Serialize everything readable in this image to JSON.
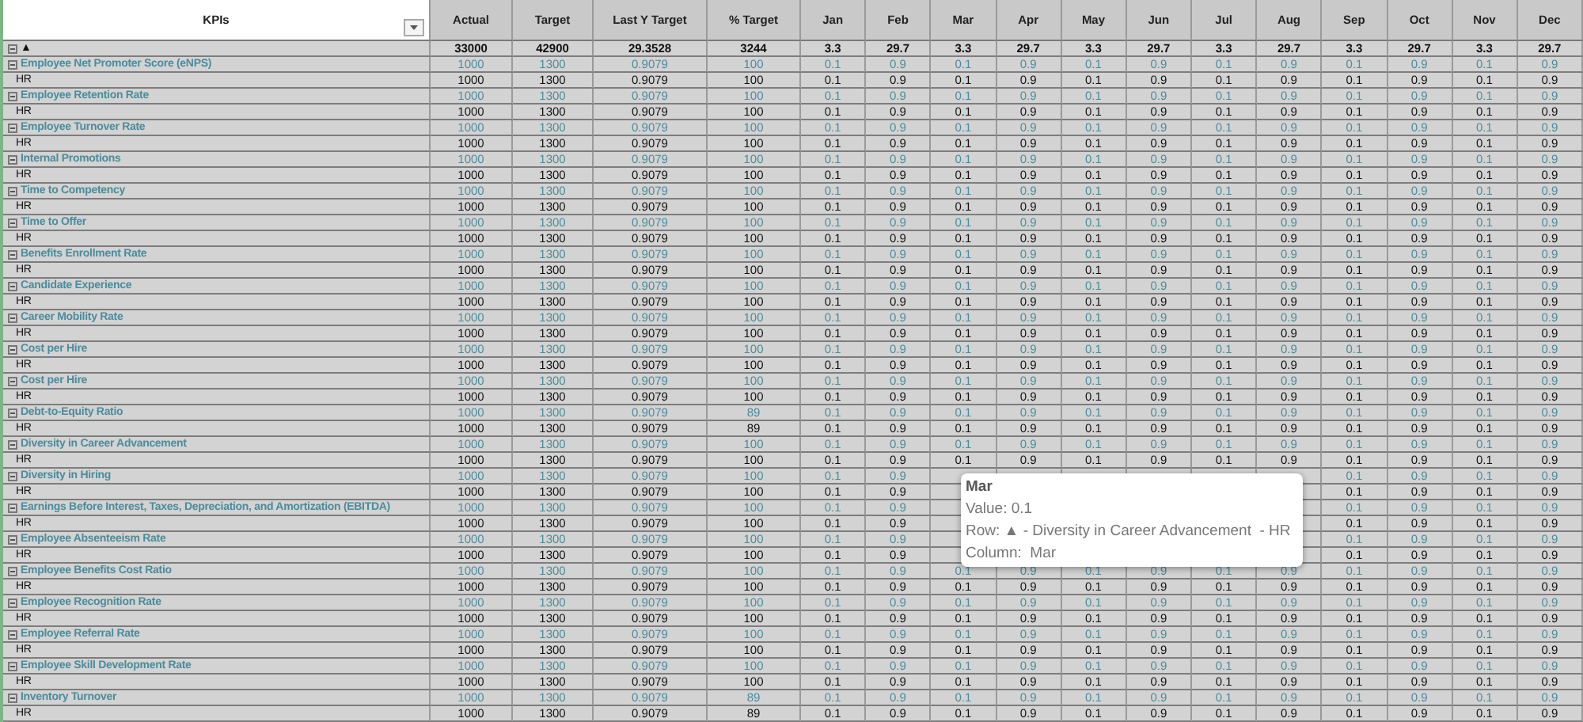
{
  "columns": [
    "KPIs",
    "Actual",
    "Target",
    "Last Y Target",
    "% Target",
    "Jan",
    "Feb",
    "Mar",
    "Apr",
    "May",
    "Jun",
    "Jul",
    "Aug",
    "Sep",
    "Oct",
    "Nov",
    "Dec"
  ],
  "rows": [
    {
      "kind": "total",
      "expanded": true,
      "label": "▲",
      "values": [
        "33000",
        "42900",
        "29.3528",
        "3244",
        "3.3",
        "29.7",
        "3.3",
        "29.7",
        "3.3",
        "29.7",
        "3.3",
        "29.7",
        "3.3",
        "29.7",
        "3.3",
        "29.7"
      ]
    },
    {
      "kind": "kpi",
      "expanded": true,
      "label": "Employee Net Promoter Score (eNPS)",
      "values": [
        "1000",
        "1300",
        "0.9079",
        "100",
        "0.1",
        "0.9",
        "0.1",
        "0.9",
        "0.1",
        "0.9",
        "0.1",
        "0.9",
        "0.1",
        "0.9",
        "0.1",
        "0.9"
      ]
    },
    {
      "kind": "sub",
      "label": "HR",
      "values": [
        "1000",
        "1300",
        "0.9079",
        "100",
        "0.1",
        "0.9",
        "0.1",
        "0.9",
        "0.1",
        "0.9",
        "0.1",
        "0.9",
        "0.1",
        "0.9",
        "0.1",
        "0.9"
      ]
    },
    {
      "kind": "kpi",
      "expanded": true,
      "label": "Employee Retention Rate",
      "values": [
        "1000",
        "1300",
        "0.9079",
        "100",
        "0.1",
        "0.9",
        "0.1",
        "0.9",
        "0.1",
        "0.9",
        "0.1",
        "0.9",
        "0.1",
        "0.9",
        "0.1",
        "0.9"
      ]
    },
    {
      "kind": "sub",
      "label": "HR",
      "values": [
        "1000",
        "1300",
        "0.9079",
        "100",
        "0.1",
        "0.9",
        "0.1",
        "0.9",
        "0.1",
        "0.9",
        "0.1",
        "0.9",
        "0.1",
        "0.9",
        "0.1",
        "0.9"
      ]
    },
    {
      "kind": "kpi",
      "expanded": true,
      "label": "Employee Turnover Rate",
      "values": [
        "1000",
        "1300",
        "0.9079",
        "100",
        "0.1",
        "0.9",
        "0.1",
        "0.9",
        "0.1",
        "0.9",
        "0.1",
        "0.9",
        "0.1",
        "0.9",
        "0.1",
        "0.9"
      ]
    },
    {
      "kind": "sub",
      "label": "HR",
      "values": [
        "1000",
        "1300",
        "0.9079",
        "100",
        "0.1",
        "0.9",
        "0.1",
        "0.9",
        "0.1",
        "0.9",
        "0.1",
        "0.9",
        "0.1",
        "0.9",
        "0.1",
        "0.9"
      ]
    },
    {
      "kind": "kpi",
      "expanded": true,
      "label": "Internal Promotions",
      "values": [
        "1000",
        "1300",
        "0.9079",
        "100",
        "0.1",
        "0.9",
        "0.1",
        "0.9",
        "0.1",
        "0.9",
        "0.1",
        "0.9",
        "0.1",
        "0.9",
        "0.1",
        "0.9"
      ]
    },
    {
      "kind": "sub",
      "label": "HR",
      "values": [
        "1000",
        "1300",
        "0.9079",
        "100",
        "0.1",
        "0.9",
        "0.1",
        "0.9",
        "0.1",
        "0.9",
        "0.1",
        "0.9",
        "0.1",
        "0.9",
        "0.1",
        "0.9"
      ]
    },
    {
      "kind": "kpi",
      "expanded": true,
      "label": "Time to Competency",
      "values": [
        "1000",
        "1300",
        "0.9079",
        "100",
        "0.1",
        "0.9",
        "0.1",
        "0.9",
        "0.1",
        "0.9",
        "0.1",
        "0.9",
        "0.1",
        "0.9",
        "0.1",
        "0.9"
      ]
    },
    {
      "kind": "sub",
      "label": "HR",
      "values": [
        "1000",
        "1300",
        "0.9079",
        "100",
        "0.1",
        "0.9",
        "0.1",
        "0.9",
        "0.1",
        "0.9",
        "0.1",
        "0.9",
        "0.1",
        "0.9",
        "0.1",
        "0.9"
      ]
    },
    {
      "kind": "kpi",
      "expanded": true,
      "label": "Time to Offer",
      "values": [
        "1000",
        "1300",
        "0.9079",
        "100",
        "0.1",
        "0.9",
        "0.1",
        "0.9",
        "0.1",
        "0.9",
        "0.1",
        "0.9",
        "0.1",
        "0.9",
        "0.1",
        "0.9"
      ]
    },
    {
      "kind": "sub",
      "label": "HR",
      "values": [
        "1000",
        "1300",
        "0.9079",
        "100",
        "0.1",
        "0.9",
        "0.1",
        "0.9",
        "0.1",
        "0.9",
        "0.1",
        "0.9",
        "0.1",
        "0.9",
        "0.1",
        "0.9"
      ]
    },
    {
      "kind": "kpi",
      "expanded": true,
      "label": "Benefits Enrollment Rate",
      "values": [
        "1000",
        "1300",
        "0.9079",
        "100",
        "0.1",
        "0.9",
        "0.1",
        "0.9",
        "0.1",
        "0.9",
        "0.1",
        "0.9",
        "0.1",
        "0.9",
        "0.1",
        "0.9"
      ]
    },
    {
      "kind": "sub",
      "label": "HR",
      "values": [
        "1000",
        "1300",
        "0.9079",
        "100",
        "0.1",
        "0.9",
        "0.1",
        "0.9",
        "0.1",
        "0.9",
        "0.1",
        "0.9",
        "0.1",
        "0.9",
        "0.1",
        "0.9"
      ]
    },
    {
      "kind": "kpi",
      "expanded": true,
      "label": "Candidate Experience",
      "values": [
        "1000",
        "1300",
        "0.9079",
        "100",
        "0.1",
        "0.9",
        "0.1",
        "0.9",
        "0.1",
        "0.9",
        "0.1",
        "0.9",
        "0.1",
        "0.9",
        "0.1",
        "0.9"
      ]
    },
    {
      "kind": "sub",
      "label": "HR",
      "values": [
        "1000",
        "1300",
        "0.9079",
        "100",
        "0.1",
        "0.9",
        "0.1",
        "0.9",
        "0.1",
        "0.9",
        "0.1",
        "0.9",
        "0.1",
        "0.9",
        "0.1",
        "0.9"
      ]
    },
    {
      "kind": "kpi",
      "expanded": true,
      "label": "Career Mobility Rate",
      "values": [
        "1000",
        "1300",
        "0.9079",
        "100",
        "0.1",
        "0.9",
        "0.1",
        "0.9",
        "0.1",
        "0.9",
        "0.1",
        "0.9",
        "0.1",
        "0.9",
        "0.1",
        "0.9"
      ]
    },
    {
      "kind": "sub",
      "label": "HR",
      "values": [
        "1000",
        "1300",
        "0.9079",
        "100",
        "0.1",
        "0.9",
        "0.1",
        "0.9",
        "0.1",
        "0.9",
        "0.1",
        "0.9",
        "0.1",
        "0.9",
        "0.1",
        "0.9"
      ]
    },
    {
      "kind": "kpi",
      "expanded": true,
      "label": "Cost per Hire",
      "values": [
        "1000",
        "1300",
        "0.9079",
        "100",
        "0.1",
        "0.9",
        "0.1",
        "0.9",
        "0.1",
        "0.9",
        "0.1",
        "0.9",
        "0.1",
        "0.9",
        "0.1",
        "0.9"
      ]
    },
    {
      "kind": "sub",
      "label": "HR",
      "values": [
        "1000",
        "1300",
        "0.9079",
        "100",
        "0.1",
        "0.9",
        "0.1",
        "0.9",
        "0.1",
        "0.9",
        "0.1",
        "0.9",
        "0.1",
        "0.9",
        "0.1",
        "0.9"
      ]
    },
    {
      "kind": "kpi",
      "expanded": true,
      "label": "Cost per Hire",
      "values": [
        "1000",
        "1300",
        "0.9079",
        "100",
        "0.1",
        "0.9",
        "0.1",
        "0.9",
        "0.1",
        "0.9",
        "0.1",
        "0.9",
        "0.1",
        "0.9",
        "0.1",
        "0.9"
      ]
    },
    {
      "kind": "sub",
      "label": "HR",
      "values": [
        "1000",
        "1300",
        "0.9079",
        "100",
        "0.1",
        "0.9",
        "0.1",
        "0.9",
        "0.1",
        "0.9",
        "0.1",
        "0.9",
        "0.1",
        "0.9",
        "0.1",
        "0.9"
      ]
    },
    {
      "kind": "kpi",
      "expanded": true,
      "label": "Debt-to-Equity Ratio",
      "values": [
        "1000",
        "1300",
        "0.9079",
        "89",
        "0.1",
        "0.9",
        "0.1",
        "0.9",
        "0.1",
        "0.9",
        "0.1",
        "0.9",
        "0.1",
        "0.9",
        "0.1",
        "0.9"
      ]
    },
    {
      "kind": "sub",
      "label": "HR",
      "values": [
        "1000",
        "1300",
        "0.9079",
        "89",
        "0.1",
        "0.9",
        "0.1",
        "0.9",
        "0.1",
        "0.9",
        "0.1",
        "0.9",
        "0.1",
        "0.9",
        "0.1",
        "0.9"
      ]
    },
    {
      "kind": "kpi",
      "expanded": true,
      "label": "Diversity in Career Advancement",
      "values": [
        "1000",
        "1300",
        "0.9079",
        "100",
        "0.1",
        "0.9",
        "0.1",
        "0.9",
        "0.1",
        "0.9",
        "0.1",
        "0.9",
        "0.1",
        "0.9",
        "0.1",
        "0.9"
      ]
    },
    {
      "kind": "sub",
      "label": "HR",
      "values": [
        "1000",
        "1300",
        "0.9079",
        "100",
        "0.1",
        "0.9",
        "0.1",
        "0.9",
        "0.1",
        "0.9",
        "0.1",
        "0.9",
        "0.1",
        "0.9",
        "0.1",
        "0.9"
      ]
    },
    {
      "kind": "kpi",
      "expanded": true,
      "label": "Diversity in Hiring",
      "values": [
        "1000",
        "1300",
        "0.9079",
        "100",
        "0.1",
        "0.9"
      ],
      "values_after_tooltip": [
        "0.1",
        "0.9",
        "0.1",
        "0.9"
      ]
    },
    {
      "kind": "sub",
      "label": "HR",
      "values": [
        "1000",
        "1300",
        "0.9079",
        "100",
        "0.1",
        "0.9"
      ],
      "values_after_tooltip": [
        "0.1",
        "0.9",
        "0.1",
        "0.9"
      ]
    },
    {
      "kind": "kpi",
      "expanded": true,
      "label": "Earnings Before Interest, Taxes, Depreciation, and Amortization (EBITDA)",
      "values": [
        "1000",
        "1300",
        "0.9079",
        "100",
        "0.1",
        "0.9"
      ],
      "values_after_tooltip": [
        "0.1",
        "0.9",
        "0.1",
        "0.9"
      ]
    },
    {
      "kind": "sub",
      "label": "HR",
      "values": [
        "1000",
        "1300",
        "0.9079",
        "100",
        "0.1",
        "0.9"
      ],
      "values_after_tooltip": [
        "0.1",
        "0.9",
        "0.1",
        "0.9"
      ]
    },
    {
      "kind": "kpi",
      "expanded": true,
      "label": "Employee Absenteeism Rate",
      "values": [
        "1000",
        "1300",
        "0.9079",
        "100",
        "0.1",
        "0.9"
      ],
      "values_after_tooltip": [
        "0.1",
        "0.9",
        "0.1",
        "0.9"
      ]
    },
    {
      "kind": "sub",
      "label": "HR",
      "values": [
        "1000",
        "1300",
        "0.9079",
        "100",
        "0.1",
        "0.9"
      ],
      "values_after_tooltip": [
        "0.1",
        "0.9",
        "0.1",
        "0.9"
      ]
    },
    {
      "kind": "kpi",
      "expanded": true,
      "label": "Employee Benefits Cost Ratio",
      "values": [
        "1000",
        "1300",
        "0.9079",
        "100",
        "0.1",
        "0.9",
        "0.1",
        "0.9",
        "0.1",
        "0.9",
        "0.1",
        "0.9",
        "0.1",
        "0.9",
        "0.1",
        "0.9"
      ]
    },
    {
      "kind": "sub",
      "label": "HR",
      "values": [
        "1000",
        "1300",
        "0.9079",
        "100",
        "0.1",
        "0.9",
        "0.1",
        "0.9",
        "0.1",
        "0.9",
        "0.1",
        "0.9",
        "0.1",
        "0.9",
        "0.1",
        "0.9"
      ]
    },
    {
      "kind": "kpi",
      "expanded": true,
      "label": "Employee Recognition Rate",
      "values": [
        "1000",
        "1300",
        "0.9079",
        "100",
        "0.1",
        "0.9",
        "0.1",
        "0.9",
        "0.1",
        "0.9",
        "0.1",
        "0.9",
        "0.1",
        "0.9",
        "0.1",
        "0.9"
      ]
    },
    {
      "kind": "sub",
      "label": "HR",
      "values": [
        "1000",
        "1300",
        "0.9079",
        "100",
        "0.1",
        "0.9",
        "0.1",
        "0.9",
        "0.1",
        "0.9",
        "0.1",
        "0.9",
        "0.1",
        "0.9",
        "0.1",
        "0.9"
      ]
    },
    {
      "kind": "kpi",
      "expanded": true,
      "label": "Employee Referral Rate",
      "values": [
        "1000",
        "1300",
        "0.9079",
        "100",
        "0.1",
        "0.9",
        "0.1",
        "0.9",
        "0.1",
        "0.9",
        "0.1",
        "0.9",
        "0.1",
        "0.9",
        "0.1",
        "0.9"
      ]
    },
    {
      "kind": "sub",
      "label": "HR",
      "values": [
        "1000",
        "1300",
        "0.9079",
        "100",
        "0.1",
        "0.9",
        "0.1",
        "0.9",
        "0.1",
        "0.9",
        "0.1",
        "0.9",
        "0.1",
        "0.9",
        "0.1",
        "0.9"
      ]
    },
    {
      "kind": "kpi",
      "expanded": true,
      "label": "Employee Skill Development Rate",
      "values": [
        "1000",
        "1300",
        "0.9079",
        "100",
        "0.1",
        "0.9",
        "0.1",
        "0.9",
        "0.1",
        "0.9",
        "0.1",
        "0.9",
        "0.1",
        "0.9",
        "0.1",
        "0.9"
      ]
    },
    {
      "kind": "sub",
      "label": "HR",
      "values": [
        "1000",
        "1300",
        "0.9079",
        "100",
        "0.1",
        "0.9",
        "0.1",
        "0.9",
        "0.1",
        "0.9",
        "0.1",
        "0.9",
        "0.1",
        "0.9",
        "0.1",
        "0.9"
      ]
    },
    {
      "kind": "kpi",
      "expanded": true,
      "label": "Inventory Turnover",
      "values": [
        "1000",
        "1300",
        "0.9079",
        "89",
        "0.1",
        "0.9",
        "0.1",
        "0.9",
        "0.1",
        "0.9",
        "0.1",
        "0.9",
        "0.1",
        "0.9",
        "0.1",
        "0.9"
      ]
    },
    {
      "kind": "sub",
      "label": "HR",
      "values": [
        "1000",
        "1300",
        "0.9079",
        "89",
        "0.1",
        "0.9",
        "0.1",
        "0.9",
        "0.1",
        "0.9",
        "0.1",
        "0.9",
        "0.1",
        "0.9",
        "0.1",
        "0.9"
      ]
    }
  ],
  "tooltip": {
    "title": "Mar",
    "lines": [
      "Value: 0.1",
      "Row: ▲ - Diversity in Career Advancement  - HR",
      "Column:  Mar"
    ]
  }
}
